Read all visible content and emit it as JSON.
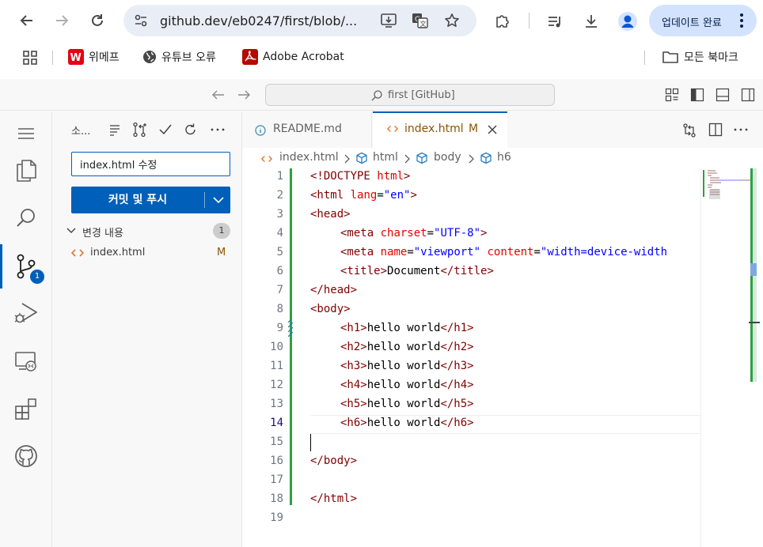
{
  "browser": {
    "url": "github.dev/eb0247/first/blob/...",
    "update_label": "업데이트 완료",
    "bookmarks": [
      {
        "label": "위메프"
      },
      {
        "label": "유튜브 오류"
      },
      {
        "label": "Adobe Acrobat"
      },
      {
        "label": "모든 북마크"
      }
    ]
  },
  "vscode": {
    "command_center": "first [GitHub]",
    "sidebar": {
      "title": "소...",
      "commit_message": "index.html 수정",
      "commit_button": "커밋 및 푸시",
      "changes_label": "변경 내용",
      "changes_count": "1",
      "file": {
        "name": "index.html",
        "status": "M"
      }
    },
    "scm_badge": "1",
    "tabs": [
      {
        "label": "README.md"
      },
      {
        "label": "index.html",
        "status": "M"
      }
    ],
    "breadcrumb": [
      "index.html",
      "html",
      "body",
      "h6"
    ],
    "line_numbers": [
      "1",
      "2",
      "3",
      "4",
      "5",
      "6",
      "7",
      "8",
      "9",
      "10",
      "11",
      "12",
      "13",
      "14",
      "15",
      "16",
      "17",
      "18",
      "19"
    ],
    "current_line": "14",
    "code": {
      "l1_doctype": "<!DOCTYPE",
      "l1_html": " html",
      "l1_end": ">",
      "l2_open": "<html",
      "l2_attr": " lang",
      "l2_eq": "=",
      "l2_val": "\"en\"",
      "l2_end": ">",
      "l3": "<head>",
      "l4_open": "<meta",
      "l4_attr": " charset",
      "l4_eq": "=",
      "l4_val": "\"UTF-8\"",
      "l4_end": ">",
      "l5_open": "<meta",
      "l5_attr1": " name",
      "l5_eq1": "=",
      "l5_val1": "\"viewport\"",
      "l5_attr2": " content",
      "l5_eq2": "=",
      "l5_val2": "\"width=device-width",
      "l6_open": "<title>",
      "l6_text": "Document",
      "l6_close": "</title>",
      "l7": "</head>",
      "l8": "<body>",
      "headings": [
        {
          "open": "<h1>",
          "text": "hello world",
          "close": "</h1>"
        },
        {
          "open": "<h2>",
          "text": "hello world",
          "close": "</h2>"
        },
        {
          "open": "<h3>",
          "text": "hello world",
          "close": "</h3>"
        },
        {
          "open": "<h4>",
          "text": "hello world",
          "close": "</h4>"
        },
        {
          "open": "<h5>",
          "text": "hello world",
          "close": "</h5>"
        },
        {
          "open": "<h6>",
          "text": "hello world",
          "close": "</h6>"
        }
      ],
      "l16": "</body>",
      "l18": "</html>"
    }
  },
  "colors": {
    "accent": "#005fb8",
    "diff_added": "#2ea043",
    "modified": "#895503",
    "tag": "#800000",
    "attr": "#e50000",
    "value": "#0000ff"
  }
}
